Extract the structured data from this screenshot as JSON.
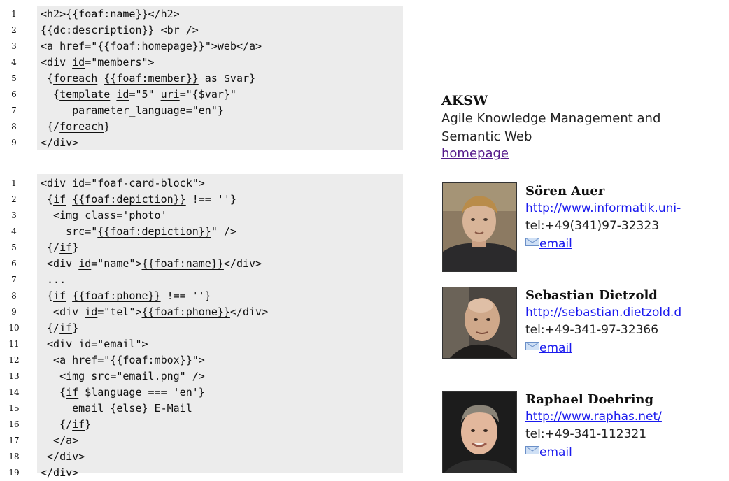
{
  "code_block_1": {
    "lines": [
      {
        "n": "1",
        "segs": [
          [
            "<h2>",
            0
          ],
          [
            "{{foaf:name}}",
            1
          ],
          [
            "</h2>",
            0
          ]
        ]
      },
      {
        "n": "2",
        "segs": [
          [
            "{{dc:description}}",
            1
          ],
          [
            " <br />",
            0
          ]
        ]
      },
      {
        "n": "3",
        "segs": [
          [
            "<a href=\"",
            0
          ],
          [
            "{{foaf:homepage}}",
            1
          ],
          [
            "\">web</a>",
            0
          ]
        ]
      },
      {
        "n": "4",
        "segs": [
          [
            "<div ",
            0
          ],
          [
            "id",
            1
          ],
          [
            "=\"members\">",
            0
          ]
        ]
      },
      {
        "n": "5",
        "segs": [
          [
            " {",
            0
          ],
          [
            "foreach",
            1
          ],
          [
            " ",
            0
          ],
          [
            "{{foaf:member}}",
            1
          ],
          [
            " as $var}",
            0
          ]
        ]
      },
      {
        "n": "6",
        "segs": [
          [
            "  {",
            0
          ],
          [
            "template",
            1
          ],
          [
            " ",
            0
          ],
          [
            "id",
            1
          ],
          [
            "=\"5\" ",
            0
          ],
          [
            "uri",
            1
          ],
          [
            "=\"{$var}\"",
            0
          ]
        ]
      },
      {
        "n": "7",
        "segs": [
          [
            "     parameter_language=\"en\"}",
            0
          ]
        ]
      },
      {
        "n": "8",
        "segs": [
          [
            " {/",
            0
          ],
          [
            "foreach",
            1
          ],
          [
            "}",
            0
          ]
        ]
      },
      {
        "n": "9",
        "segs": [
          [
            "</div>",
            0
          ]
        ]
      }
    ]
  },
  "code_block_2": {
    "lines": [
      {
        "n": "1",
        "segs": [
          [
            "<div ",
            0
          ],
          [
            "id",
            1
          ],
          [
            "=\"foaf-card-block\">",
            0
          ]
        ]
      },
      {
        "n": "2",
        "segs": [
          [
            " {",
            0
          ],
          [
            "if",
            1
          ],
          [
            " ",
            0
          ],
          [
            "{{foaf:depiction}}",
            1
          ],
          [
            " !== ''}",
            0
          ]
        ]
      },
      {
        "n": "3",
        "segs": [
          [
            "  <img class='photo'",
            0
          ]
        ]
      },
      {
        "n": "4",
        "segs": [
          [
            "    src=\"",
            0
          ],
          [
            "{{foaf:depiction}}",
            1
          ],
          [
            "\" />",
            0
          ]
        ]
      },
      {
        "n": "5",
        "segs": [
          [
            " {/",
            0
          ],
          [
            "if",
            1
          ],
          [
            "}",
            0
          ]
        ]
      },
      {
        "n": "6",
        "segs": [
          [
            " <div ",
            0
          ],
          [
            "id",
            1
          ],
          [
            "=\"name\">",
            0
          ],
          [
            "{{foaf:name}}",
            1
          ],
          [
            "</div>",
            0
          ]
        ]
      },
      {
        "n": "7",
        "segs": [
          [
            " ...",
            0
          ]
        ]
      },
      {
        "n": "8",
        "segs": [
          [
            " {",
            0
          ],
          [
            "if",
            1
          ],
          [
            " ",
            0
          ],
          [
            "{{foaf:phone}}",
            1
          ],
          [
            " !== ''}",
            0
          ]
        ]
      },
      {
        "n": "9",
        "segs": [
          [
            "  <div ",
            0
          ],
          [
            "id",
            1
          ],
          [
            "=\"tel\">",
            0
          ],
          [
            "{{foaf:phone}}",
            1
          ],
          [
            "</div>",
            0
          ]
        ]
      },
      {
        "n": "10",
        "segs": [
          [
            " {/",
            0
          ],
          [
            "if",
            1
          ],
          [
            "}",
            0
          ]
        ]
      },
      {
        "n": "11",
        "segs": [
          [
            " <div ",
            0
          ],
          [
            "id",
            1
          ],
          [
            "=\"email\">",
            0
          ]
        ]
      },
      {
        "n": "12",
        "segs": [
          [
            "  <a href=\"",
            0
          ],
          [
            "{{foaf:mbox}}",
            1
          ],
          [
            "\">",
            0
          ]
        ]
      },
      {
        "n": "13",
        "segs": [
          [
            "   <img src=\"email.png\" />",
            0
          ]
        ]
      },
      {
        "n": "14",
        "segs": [
          [
            "   {",
            0
          ],
          [
            "if",
            1
          ],
          [
            " $language === 'en'}",
            0
          ]
        ]
      },
      {
        "n": "15",
        "segs": [
          [
            "     email {else} E-Mail",
            0
          ]
        ]
      },
      {
        "n": "16",
        "segs": [
          [
            "   {/",
            0
          ],
          [
            "if",
            1
          ],
          [
            "}",
            0
          ]
        ]
      },
      {
        "n": "17",
        "segs": [
          [
            "  </a>",
            0
          ]
        ]
      },
      {
        "n": "18",
        "segs": [
          [
            " </div>",
            0
          ]
        ]
      },
      {
        "n": "19",
        "segs": [
          [
            "</div>",
            0
          ]
        ]
      }
    ]
  },
  "preview": {
    "org_name": "AKSW",
    "org_description": "Agile Knowledge Management and Semantic Web",
    "homepage_label": "homepage",
    "members": [
      {
        "name": "Sören Auer",
        "url": "http://www.informatik.uni-",
        "tel": "tel:+49(341)97-32323",
        "email_label": "email"
      },
      {
        "name": "Sebastian Dietzold",
        "url": "http://sebastian.dietzold.d",
        "tel": "tel:+49-341-97-32366",
        "email_label": "email"
      },
      {
        "name": "Raphael Doehring",
        "url": "http://www.raphas.net/",
        "tel": "tel:+49-341-112321",
        "email_label": "email"
      }
    ]
  },
  "colors": {
    "code_background": "#ececec",
    "link": "#1a1aee",
    "visited_link": "#551a8b"
  }
}
